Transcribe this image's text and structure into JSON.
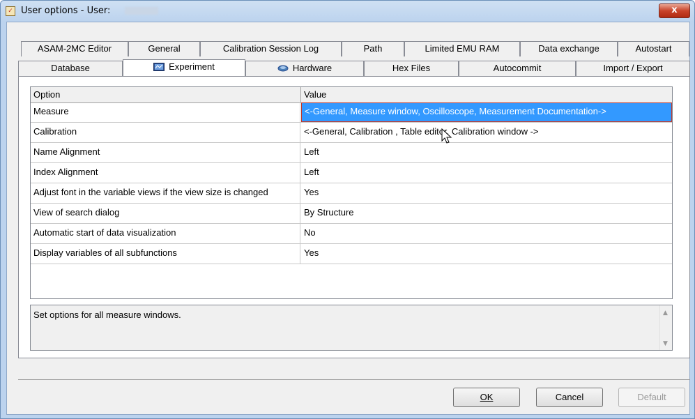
{
  "window": {
    "title": "User options - User:",
    "close_label": "x"
  },
  "tabs": {
    "row1": [
      {
        "label": "ASAM-2MC Editor"
      },
      {
        "label": "General"
      },
      {
        "label": "Calibration Session Log"
      },
      {
        "label": "Path"
      },
      {
        "label": "Limited EMU RAM"
      },
      {
        "label": "Data exchange"
      },
      {
        "label": "Autostart"
      }
    ],
    "row2": [
      {
        "label": "Database"
      },
      {
        "label": "Experiment"
      },
      {
        "label": "Hardware"
      },
      {
        "label": "Hex Files"
      },
      {
        "label": "Autocommit"
      },
      {
        "label": "Import / Export"
      }
    ]
  },
  "grid": {
    "headers": {
      "option": "Option",
      "value": "Value"
    },
    "rows": [
      {
        "option": "Measure",
        "value": "<-General, Measure window, Oscilloscope, Measurement Documentation->"
      },
      {
        "option": "Calibration",
        "value": "<-General, Calibration , Table editor, Calibration window ->"
      },
      {
        "option": "Name Alignment",
        "value": "Left"
      },
      {
        "option": "Index Alignment",
        "value": "Left"
      },
      {
        "option": "Adjust font in the variable views if the view size is changed",
        "value": "Yes"
      },
      {
        "option": "View of search dialog",
        "value": "By Structure"
      },
      {
        "option": "Automatic start of data visualization",
        "value": "No"
      },
      {
        "option": "Display variables of all subfunctions",
        "value": "Yes"
      }
    ],
    "selected_row": 0
  },
  "description": "Set options for all measure windows.",
  "buttons": {
    "ok": "OK",
    "cancel": "Cancel",
    "default": "Default"
  },
  "colors": {
    "selection": "#3399ff",
    "close_button": "#c8432a"
  }
}
